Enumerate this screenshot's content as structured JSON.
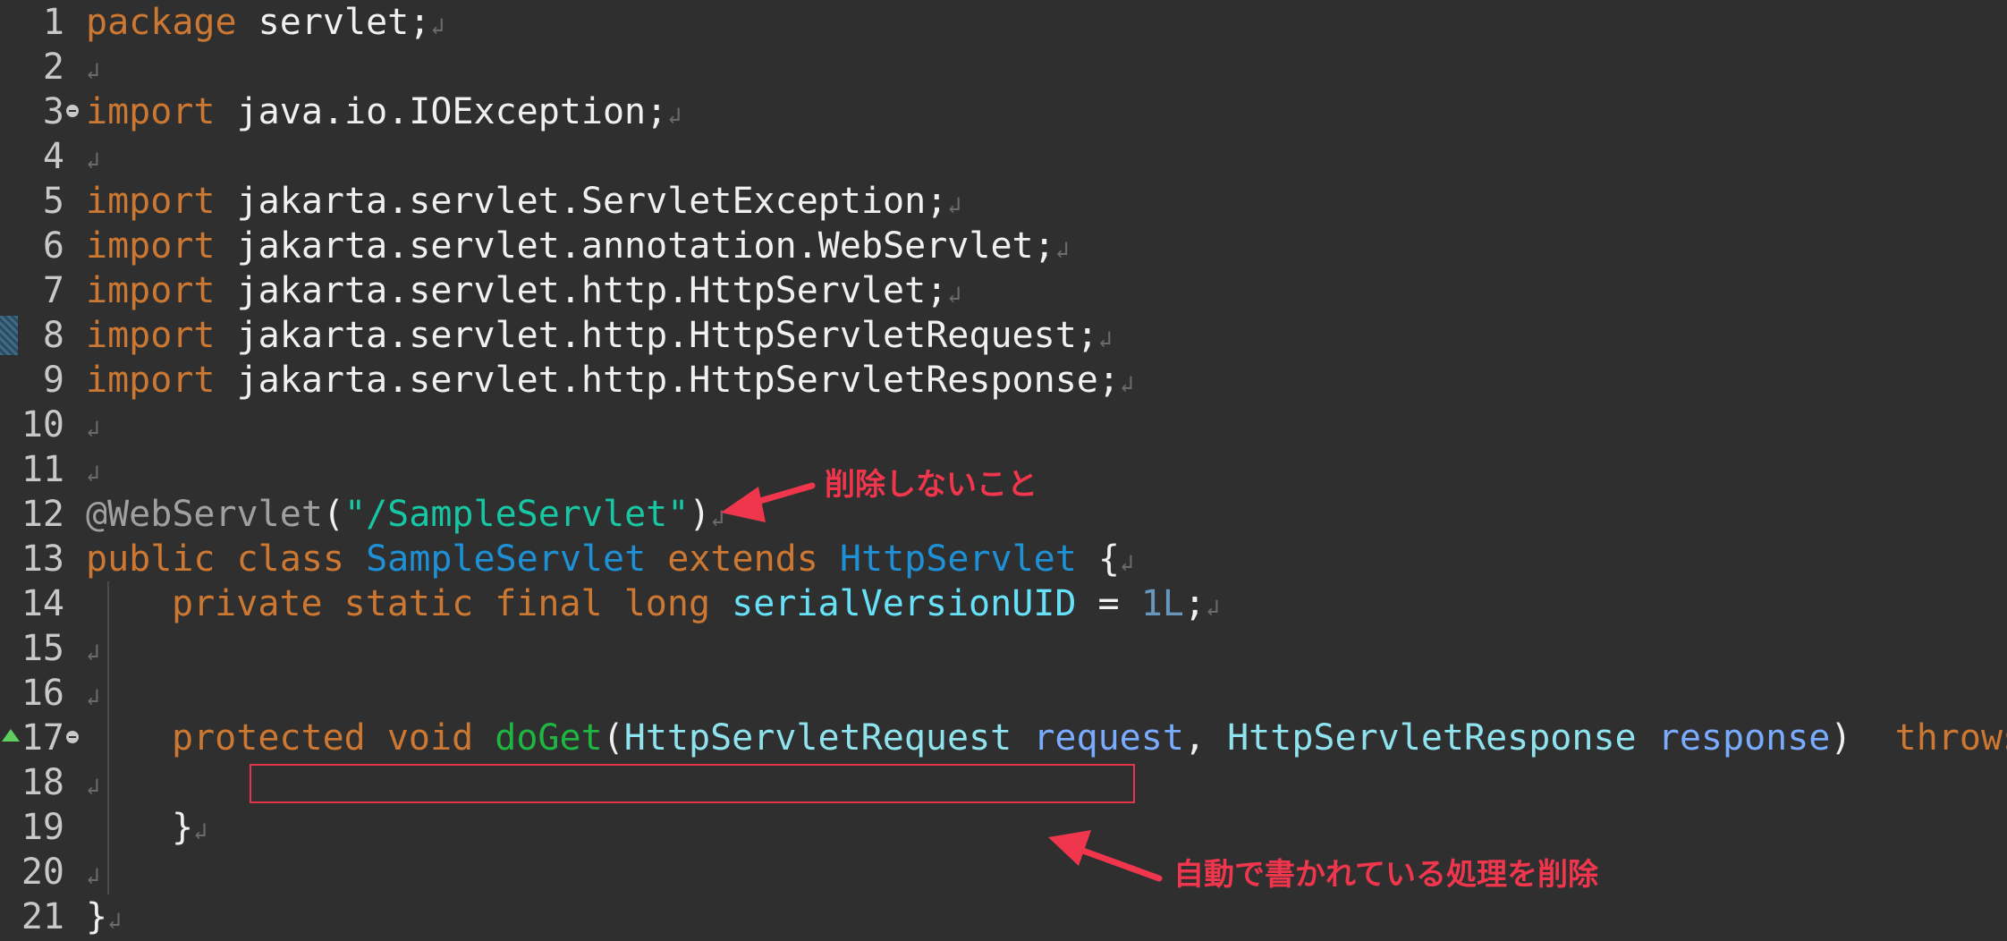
{
  "editor": {
    "lines": [
      {
        "n": "1",
        "tokens": [
          [
            "kw",
            "package"
          ],
          [
            "plain",
            " servlet;"
          ]
        ]
      },
      {
        "n": "2",
        "tokens": []
      },
      {
        "n": "3",
        "fold": true,
        "tokens": [
          [
            "kw",
            "import"
          ],
          [
            "plain",
            " java.io.IOException;"
          ]
        ]
      },
      {
        "n": "4",
        "tokens": []
      },
      {
        "n": "5",
        "tokens": [
          [
            "kw",
            "import"
          ],
          [
            "plain",
            " jakarta.servlet.ServletException;"
          ]
        ]
      },
      {
        "n": "6",
        "tokens": [
          [
            "kw",
            "import"
          ],
          [
            "plain",
            " jakarta.servlet.annotation.WebServlet;"
          ]
        ]
      },
      {
        "n": "7",
        "tokens": [
          [
            "kw",
            "import"
          ],
          [
            "plain",
            " jakarta.servlet.http.HttpServlet;"
          ]
        ]
      },
      {
        "n": "8",
        "change": true,
        "tokens": [
          [
            "kw",
            "import"
          ],
          [
            "plain",
            " jakarta.servlet.http.HttpServletRequest;"
          ]
        ]
      },
      {
        "n": "9",
        "tokens": [
          [
            "kw",
            "import"
          ],
          [
            "plain",
            " jakarta.servlet.http.HttpServletResponse;"
          ]
        ]
      },
      {
        "n": "10",
        "tokens": []
      },
      {
        "n": "11",
        "tokens": []
      },
      {
        "n": "12",
        "tokens": [
          [
            "ann",
            "@WebServlet"
          ],
          [
            "plain",
            "("
          ],
          [
            "str",
            "\"/SampleServlet\""
          ],
          [
            "plain",
            ")"
          ]
        ]
      },
      {
        "n": "13",
        "tokens": [
          [
            "kw",
            "public class "
          ],
          [
            "type",
            "SampleServlet"
          ],
          [
            "kw",
            " extends "
          ],
          [
            "type",
            "HttpServlet"
          ],
          [
            "plain",
            " {"
          ]
        ]
      },
      {
        "n": "14",
        "indent": 1,
        "tokens": [
          [
            "kw",
            "private static final long "
          ],
          [
            "field",
            "serialVersionUID"
          ],
          [
            "plain",
            " = "
          ],
          [
            "num",
            "1L"
          ],
          [
            "plain",
            ";"
          ]
        ]
      },
      {
        "n": "15",
        "tokens": []
      },
      {
        "n": "16",
        "tokens": []
      },
      {
        "n": "17",
        "fold": true,
        "override": true,
        "indent": 1,
        "tokens": [
          [
            "kw",
            "protected void "
          ],
          [
            "method",
            "doGet"
          ],
          [
            "plain",
            "("
          ],
          [
            "type2",
            "HttpServletRequest"
          ],
          [
            "plain",
            " "
          ],
          [
            "param",
            "request"
          ],
          [
            "plain",
            ", "
          ],
          [
            "type2",
            "HttpServletResponse"
          ],
          [
            "plain",
            " "
          ],
          [
            "param",
            "response"
          ],
          [
            "plain",
            ")  "
          ],
          [
            "kw",
            "throws"
          ]
        ]
      },
      {
        "n": "18",
        "tokens": []
      },
      {
        "n": "19",
        "indent": 1,
        "tokens": [
          [
            "plain",
            "}"
          ]
        ]
      },
      {
        "n": "20",
        "tokens": []
      },
      {
        "n": "21",
        "tokens": [
          [
            "plain",
            "}"
          ]
        ]
      }
    ],
    "return_glyph": "↲"
  },
  "annotations": {
    "note_keep": "削除しないこと",
    "note_remove": "自動で書かれている処理を削除"
  },
  "colors": {
    "background": "#2f2f2f",
    "keyword": "#cc7832",
    "annotation_red": "#f0364d"
  }
}
